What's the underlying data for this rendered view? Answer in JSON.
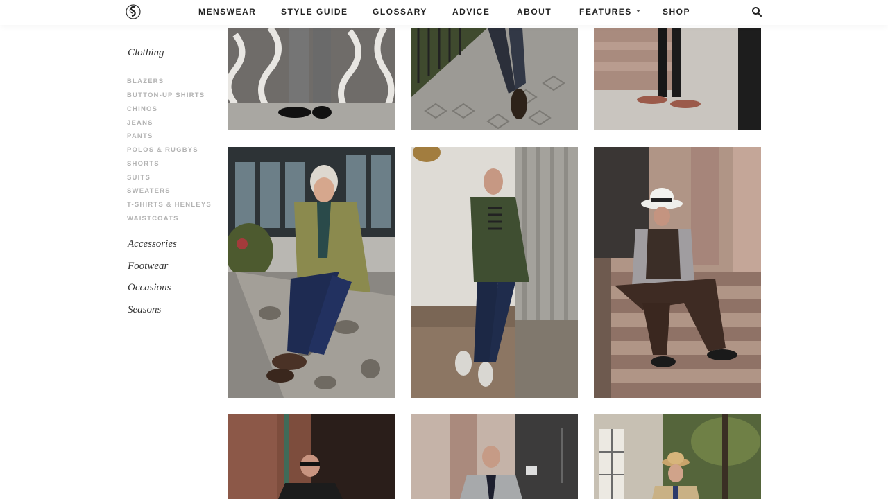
{
  "header": {
    "logo_icon": "style-girlfriend-monogram-icon",
    "nav": [
      {
        "label": "MENSWEAR"
      },
      {
        "label": "STYLE GUIDE"
      },
      {
        "label": "GLOSSARY"
      },
      {
        "label": "ADVICE"
      },
      {
        "label": "ABOUT"
      },
      {
        "label": "FEATURES",
        "has_dropdown": true
      },
      {
        "label": "SHOP"
      }
    ],
    "search_icon": "search-icon"
  },
  "sidebar": {
    "clothing": {
      "title": "Clothing",
      "items": [
        "BLAZERS",
        "BUTTON-UP SHIRTS",
        "CHINOS",
        "JEANS",
        "PANTS",
        "POLOS & RUGBYS",
        "SHORTS",
        "SUITS",
        "SWEATERS",
        "T-SHIRTS & HENLEYS",
        "WAISTCOATS"
      ]
    },
    "sections": [
      "Accessories",
      "Footwear",
      "Occasions",
      "Seasons"
    ]
  },
  "colors": {
    "nav_text": "#222222",
    "sidebar_sub": "#b3b3b3",
    "sidebar_title": "#333333",
    "background": "#ffffff"
  }
}
